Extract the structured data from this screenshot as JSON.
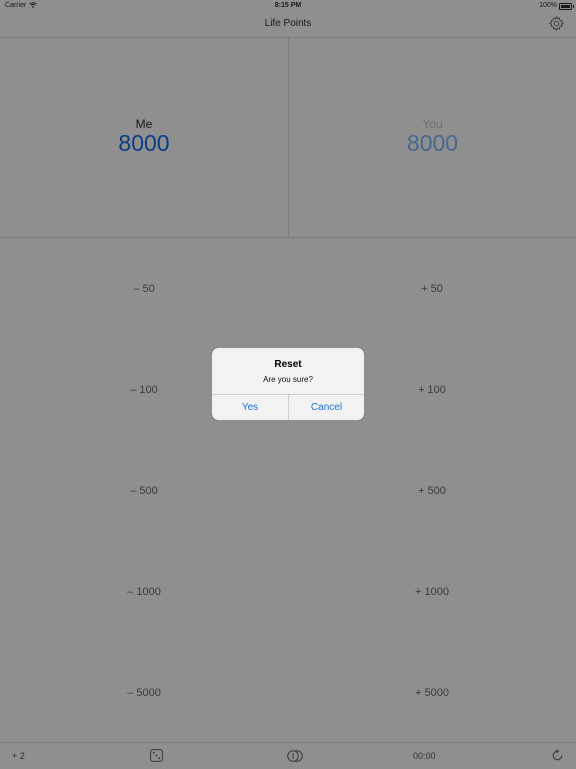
{
  "status": {
    "carrier": "Carrier",
    "time": "8:15 PM",
    "battery": "100%"
  },
  "nav": {
    "title": "Life Points"
  },
  "players": {
    "me": {
      "name": "Me",
      "score": "8000"
    },
    "you": {
      "name": "You",
      "score": "8000"
    }
  },
  "adjustments": {
    "minus": [
      "– 50",
      "– 100",
      "– 500",
      "– 1000",
      "– 5000"
    ],
    "plus": [
      "+ 50",
      "+ 100",
      "+ 500",
      "+ 1000",
      "+ 5000"
    ]
  },
  "toolbar": {
    "plus_two": "+ 2",
    "timer": "00:00"
  },
  "alert": {
    "title": "Reset",
    "message": "Are you sure?",
    "yes": "Yes",
    "cancel": "Cancel"
  },
  "colors": {
    "accent": "#1f6fd0",
    "me_score": "#0a3e86",
    "you_score": "#46688f",
    "dim_background": "#8f8f8f"
  },
  "icons": {
    "settings": "gear-icon",
    "dice": "dice-icon",
    "coin": "coin-icon",
    "reset": "reset-icon",
    "wifi": "wifi-icon",
    "battery": "battery-icon"
  }
}
